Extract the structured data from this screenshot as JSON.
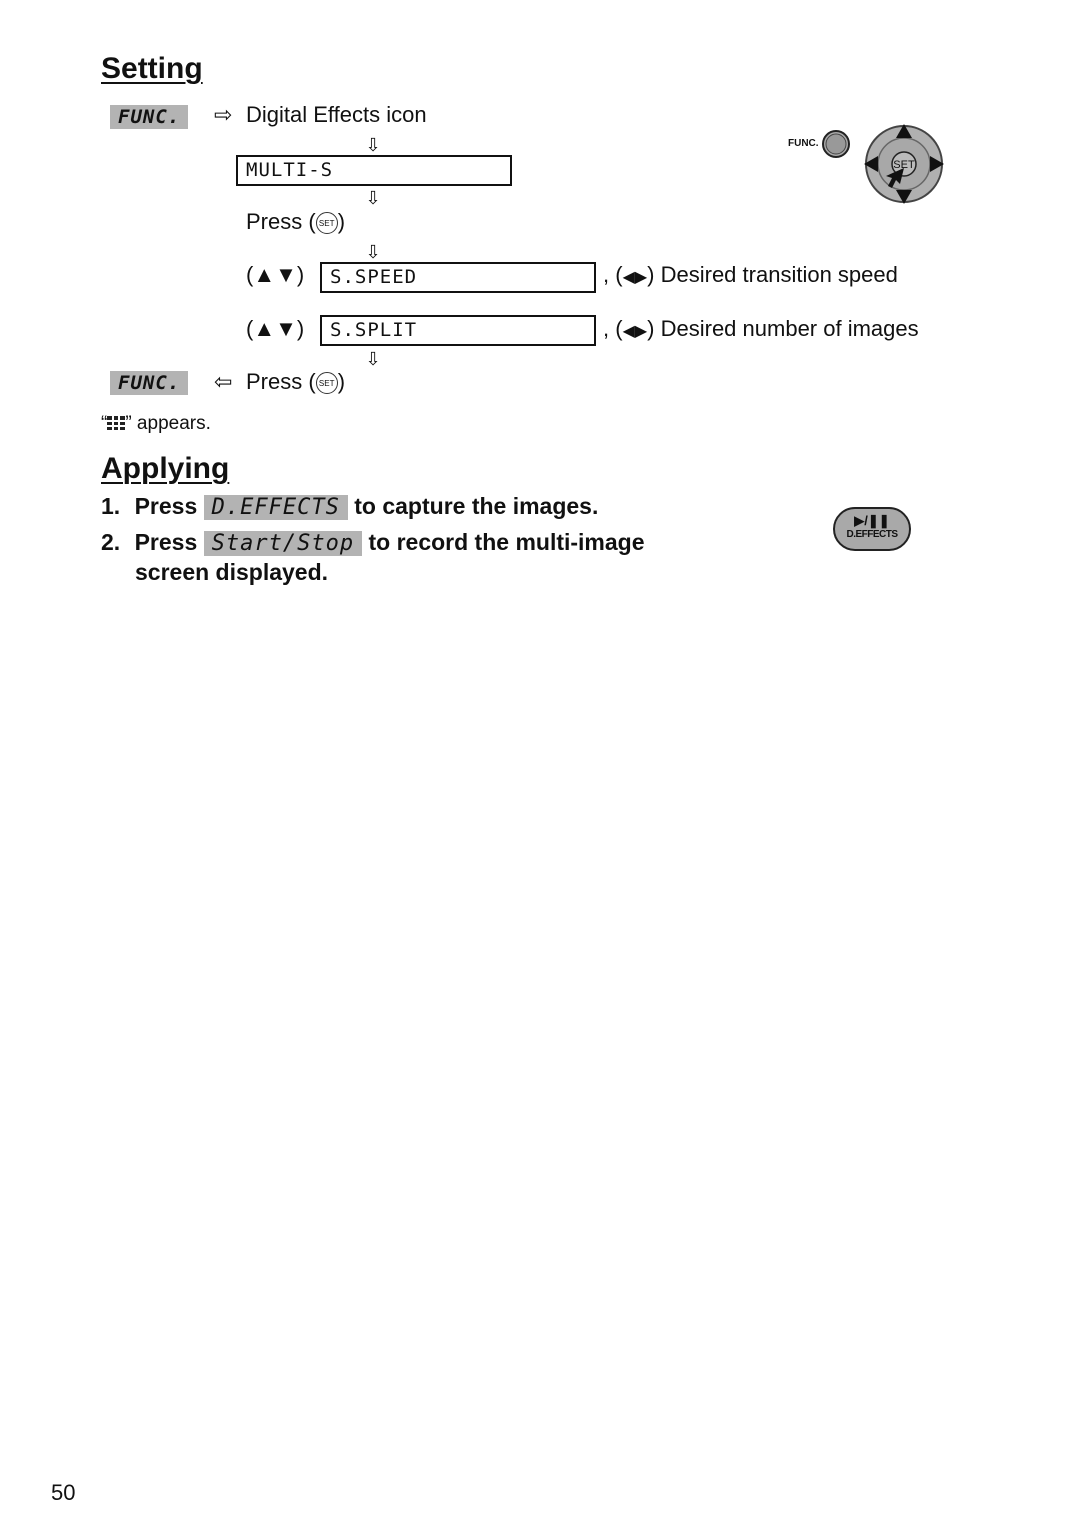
{
  "setting": {
    "heading": "Setting",
    "func_label": "FUNC.",
    "step1_arrow": "⇨",
    "step1_text": "Digital Effects icon",
    "down_arrow": "⇩",
    "menu_multi": "MULTI-S",
    "press_label": "Press (",
    "press_close": ")",
    "set_icon_label": "SET",
    "updown_label": "(▲▼)",
    "menu_speed": "S.SPEED",
    "speed_suffix_prefix": ", (",
    "leftright": "◀▶",
    "speed_suffix": ") Desired transition speed",
    "menu_split": "S.SPLIT",
    "split_suffix": ") Desired number of images",
    "return_arrow": "⇦",
    "appears_open": "“",
    "appears_close": "” appears."
  },
  "camera_diagram": {
    "func_label": "FUNC.",
    "set_label": "SET"
  },
  "applying": {
    "heading": "Applying",
    "steps": [
      {
        "num": "1.",
        "pre": "Press",
        "key": "D.EFFECTS",
        "post": "to capture the images."
      },
      {
        "num": "2.",
        "pre": "Press",
        "key": "Start/Stop",
        "post": "to record the multi-image",
        "post2": "screen displayed."
      }
    ],
    "button_icon_top": "▶/❚❚",
    "button_icon_label": "D.EFFECTS"
  },
  "page_number": "50"
}
